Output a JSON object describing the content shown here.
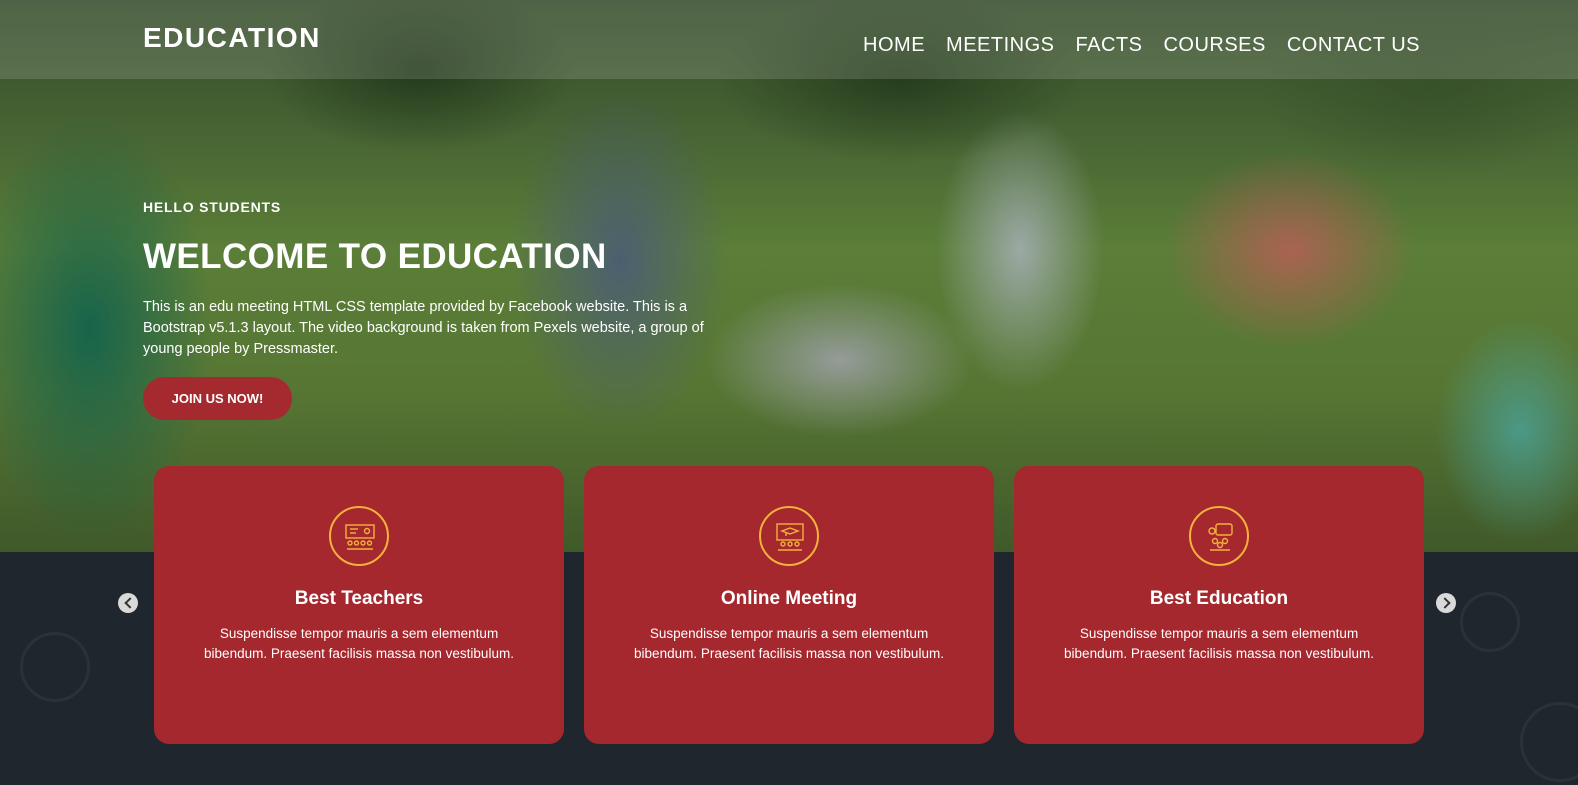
{
  "header": {
    "logo": "EDUCATION",
    "nav": [
      "HOME",
      "MEETINGS",
      "FACTS",
      "COURSES",
      "CONTACT US"
    ]
  },
  "hero": {
    "eyebrow": "HELLO STUDENTS",
    "title": "WELCOME TO EDUCATION",
    "description": "This is an edu meeting HTML CSS template provided by Facebook website. This is a Bootstrap v5.1.3 layout. The video background is taken from Pexels website, a group of young people by Pressmaster.",
    "cta_label": "JOIN US NOW!"
  },
  "services": [
    {
      "icon": "teacher-icon",
      "title": "Best Teachers",
      "text": "Suspendisse tempor mauris a sem elementum bibendum. Praesent facilisis massa non vestibulum."
    },
    {
      "icon": "online-meeting-icon",
      "title": "Online Meeting",
      "text": "Suspendisse tempor mauris a sem elementum bibendum. Praesent facilisis massa non vestibulum."
    },
    {
      "icon": "education-icon",
      "title": "Best Education",
      "text": "Suspendisse tempor mauris a sem elementum bibendum. Praesent facilisis massa non vestibulum."
    }
  ],
  "colors": {
    "accent": "#a4282d",
    "icon_ring": "#f4b13c",
    "band": "#1f262d"
  }
}
